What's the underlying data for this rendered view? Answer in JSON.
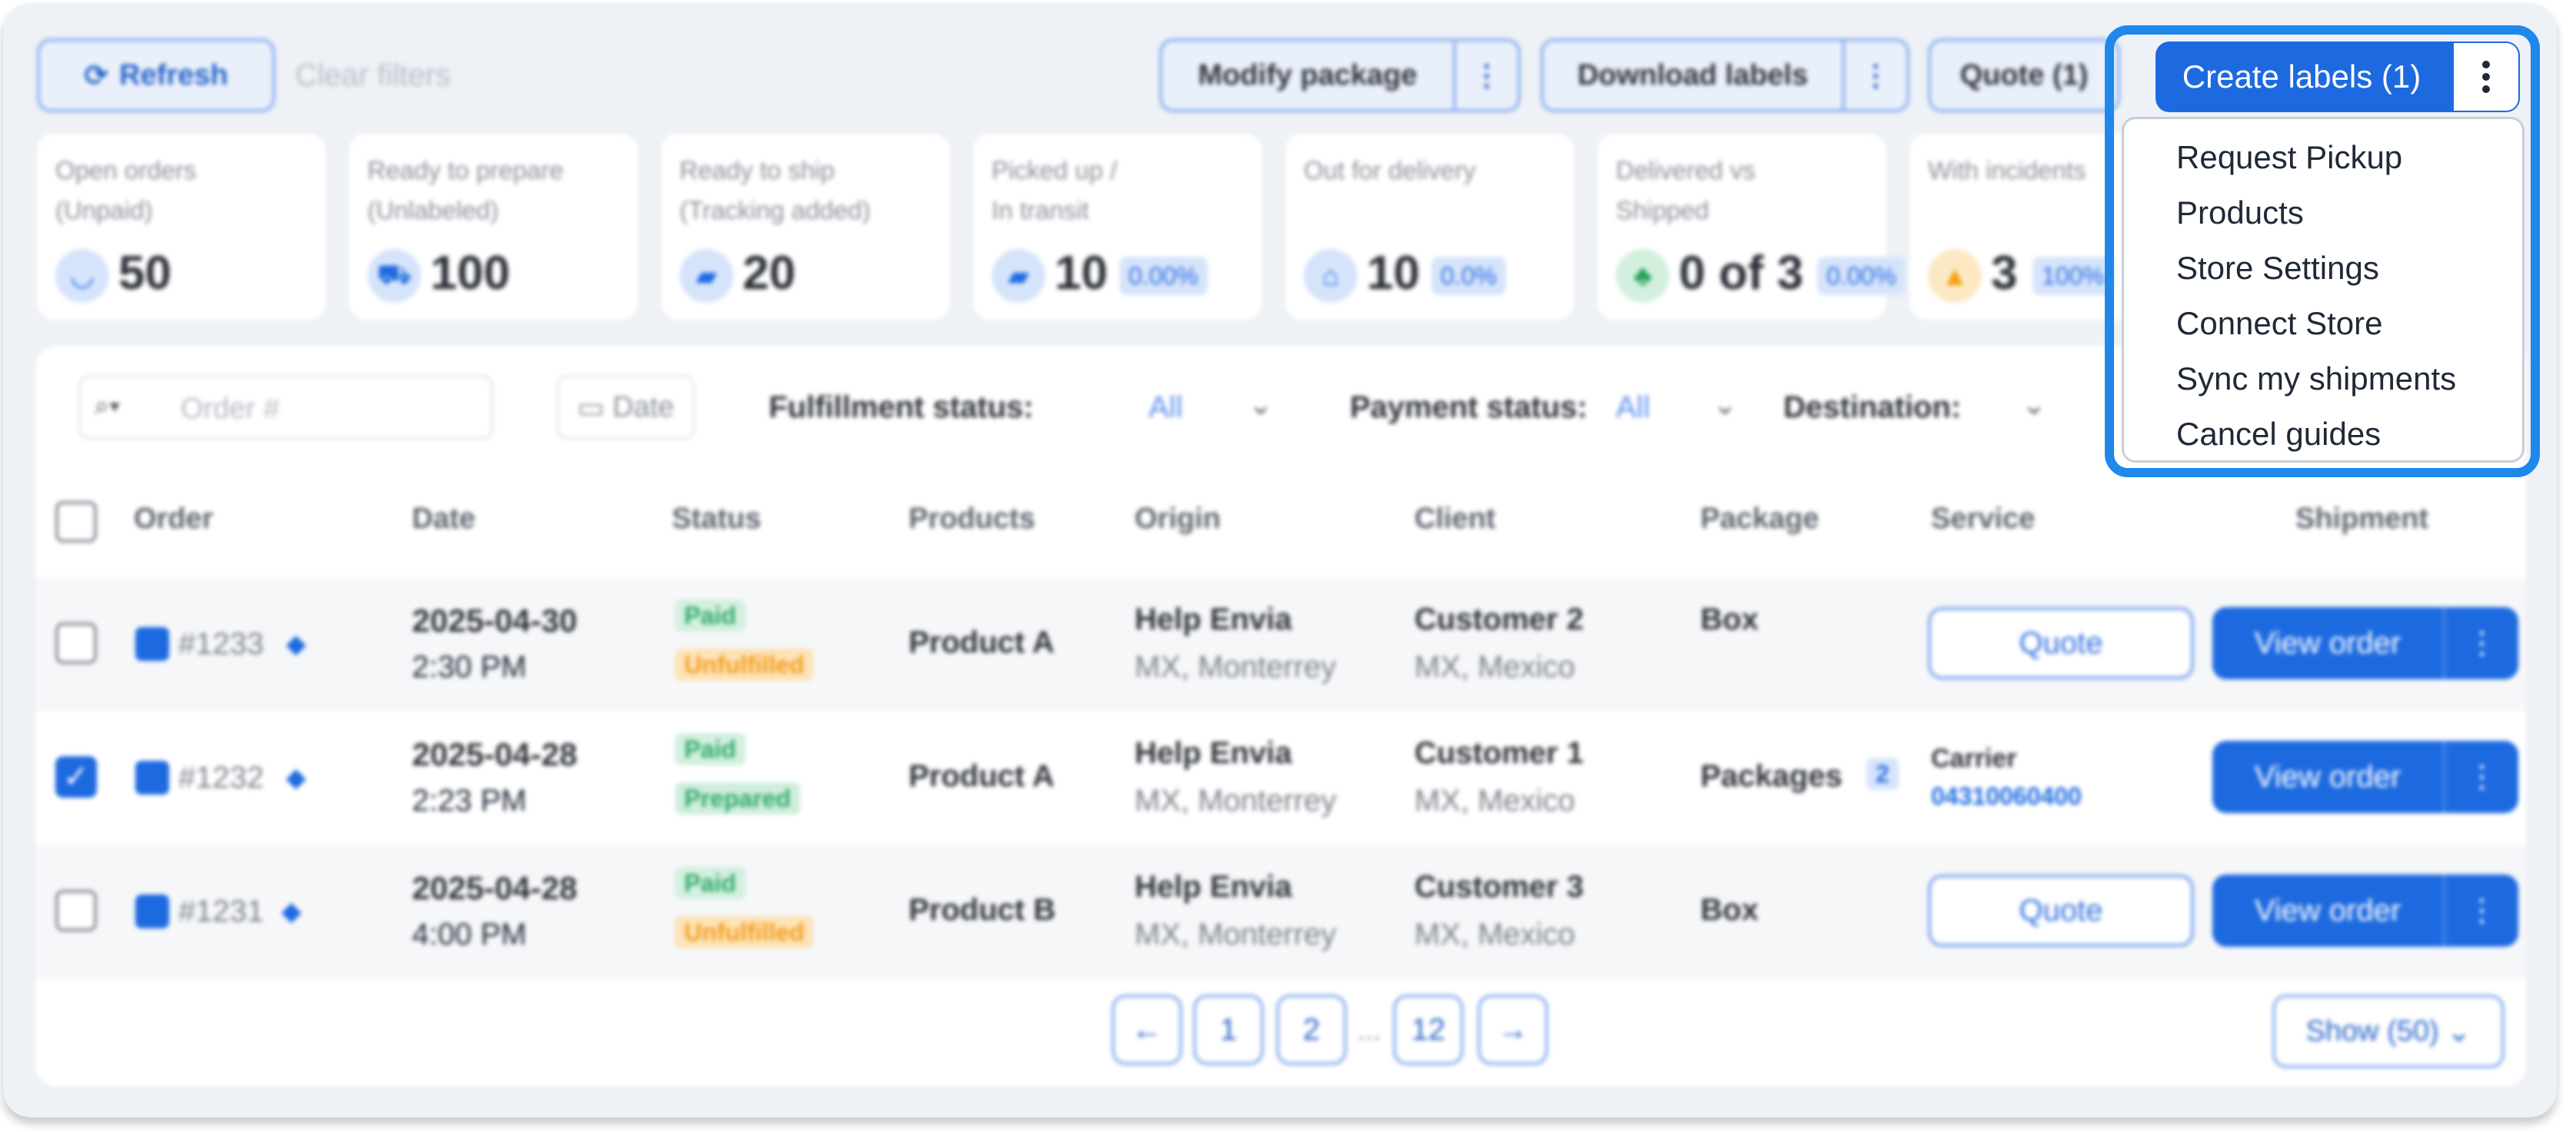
{
  "toolbar": {
    "refresh": "Refresh",
    "clear_filters": "Clear filters",
    "modify_package": "Modify package",
    "download_labels": "Download labels",
    "quote": "Quote (1)",
    "create_labels": "Create labels (1)"
  },
  "dropdown": {
    "items": [
      "Request Pickup",
      "Products",
      "Store Settings",
      "Connect Store",
      "Sync my shipments",
      "Cancel guides"
    ]
  },
  "stats": [
    {
      "label": "Open orders\n(Unpaid)",
      "value": "50",
      "pct": ""
    },
    {
      "label": "Ready to prepare\n(Unlabeled)",
      "value": "100",
      "pct": ""
    },
    {
      "label": "Ready to ship\n(Tracking added)",
      "value": "20",
      "pct": ""
    },
    {
      "label": "Picked up /\nIn transit",
      "value": "10",
      "pct": "0.00%"
    },
    {
      "label": "Out for delivery",
      "value": "10",
      "pct": "0.0%"
    },
    {
      "label": "Delivered vs\nShipped",
      "value": "0 of 3",
      "pct": "0.00%"
    },
    {
      "label": "With incidents",
      "value": "3",
      "pct": "100%"
    }
  ],
  "filters": {
    "order_placeholder": "Order #",
    "date": "Date",
    "fulfillment_label": "Fulfillment status:",
    "fulfillment_value": "All",
    "payment_label": "Payment status:",
    "payment_value": "All",
    "destination_label": "Destination:"
  },
  "table": {
    "headers": {
      "order": "Order",
      "date": "Date",
      "status": "Status",
      "products": "Products",
      "origin": "Origin",
      "client": "Client",
      "package": "Package",
      "service": "Service",
      "shipment": "Shipment"
    },
    "rows": [
      {
        "order": "#1233",
        "date": "2025-04-30",
        "time": "2:30 PM",
        "pay": "Paid",
        "fulfill": "Unfulfilled",
        "product": "Product A",
        "origin": "Help Envia",
        "origin_loc": "MX, Monterrey",
        "client": "Customer 2",
        "client_loc": "MX, Mexico",
        "package": "Box",
        "service": "Quote",
        "view": "View order"
      },
      {
        "order": "#1232",
        "date": "2025-04-28",
        "time": "2:23 PM",
        "pay": "Paid",
        "fulfill": "Prepared",
        "product": "Product A",
        "origin": "Help Envia",
        "origin_loc": "MX, Monterrey",
        "client": "Customer 1",
        "client_loc": "MX, Mexico",
        "package": "Packages",
        "package_count": "2",
        "carrier": "Carrier",
        "tracking": "04310060400",
        "view": "View order"
      },
      {
        "order": "#1231",
        "date": "2025-04-28",
        "time": "4:00 PM",
        "pay": "Paid",
        "fulfill": "Unfulfilled",
        "product": "Product B",
        "origin": "Help Envia",
        "origin_loc": "MX, Monterrey",
        "client": "Customer 3",
        "client_loc": "MX, Mexico",
        "package": "Box",
        "service": "Quote",
        "view": "View order"
      }
    ]
  },
  "pagination": {
    "prev": "←",
    "p1": "1",
    "p2": "2",
    "ellipsis": "...",
    "last": "12",
    "next": "→",
    "show": "Show (50)"
  },
  "colors": {
    "primary": "#1d6ae0",
    "highlight": "#1f88ea",
    "paid": "#d3f0df",
    "unfulfilled": "#fde3b8",
    "prepared": "#cfeedd"
  }
}
